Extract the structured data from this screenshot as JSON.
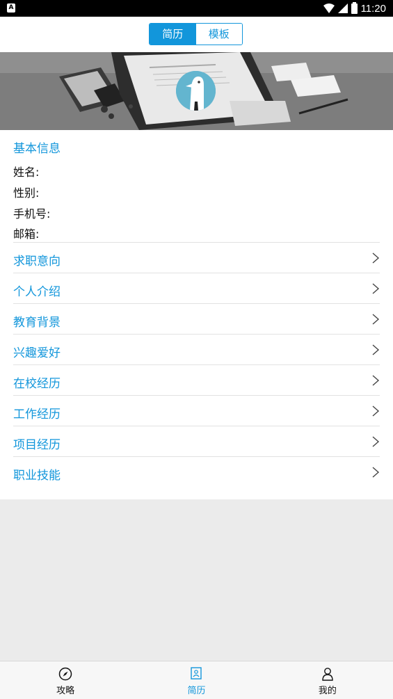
{
  "status_bar": {
    "time": "11:20",
    "app_badge": "A"
  },
  "segment": {
    "tabs": [
      {
        "label": "简历",
        "active": true
      },
      {
        "label": "模板",
        "active": false
      }
    ]
  },
  "basic_info": {
    "title": "基本信息",
    "fields": [
      {
        "label": "姓名:"
      },
      {
        "label": "性别:"
      },
      {
        "label": "手机号:"
      },
      {
        "label": "邮箱:"
      }
    ]
  },
  "sections": [
    {
      "label": "求职意向"
    },
    {
      "label": "个人介绍"
    },
    {
      "label": "教育背景"
    },
    {
      "label": "兴趣爱好"
    },
    {
      "label": "在校经历"
    },
    {
      "label": "工作经历"
    },
    {
      "label": "项目经历"
    },
    {
      "label": "职业技能"
    }
  ],
  "bottom_nav": [
    {
      "label": "攻略",
      "icon": "compass-icon",
      "active": false
    },
    {
      "label": "简历",
      "icon": "resume-icon",
      "active": true
    },
    {
      "label": "我的",
      "icon": "user-icon",
      "active": false
    }
  ],
  "colors": {
    "accent": "#1296db",
    "background": "#ebebeb",
    "avatar": "#63b5cf"
  }
}
